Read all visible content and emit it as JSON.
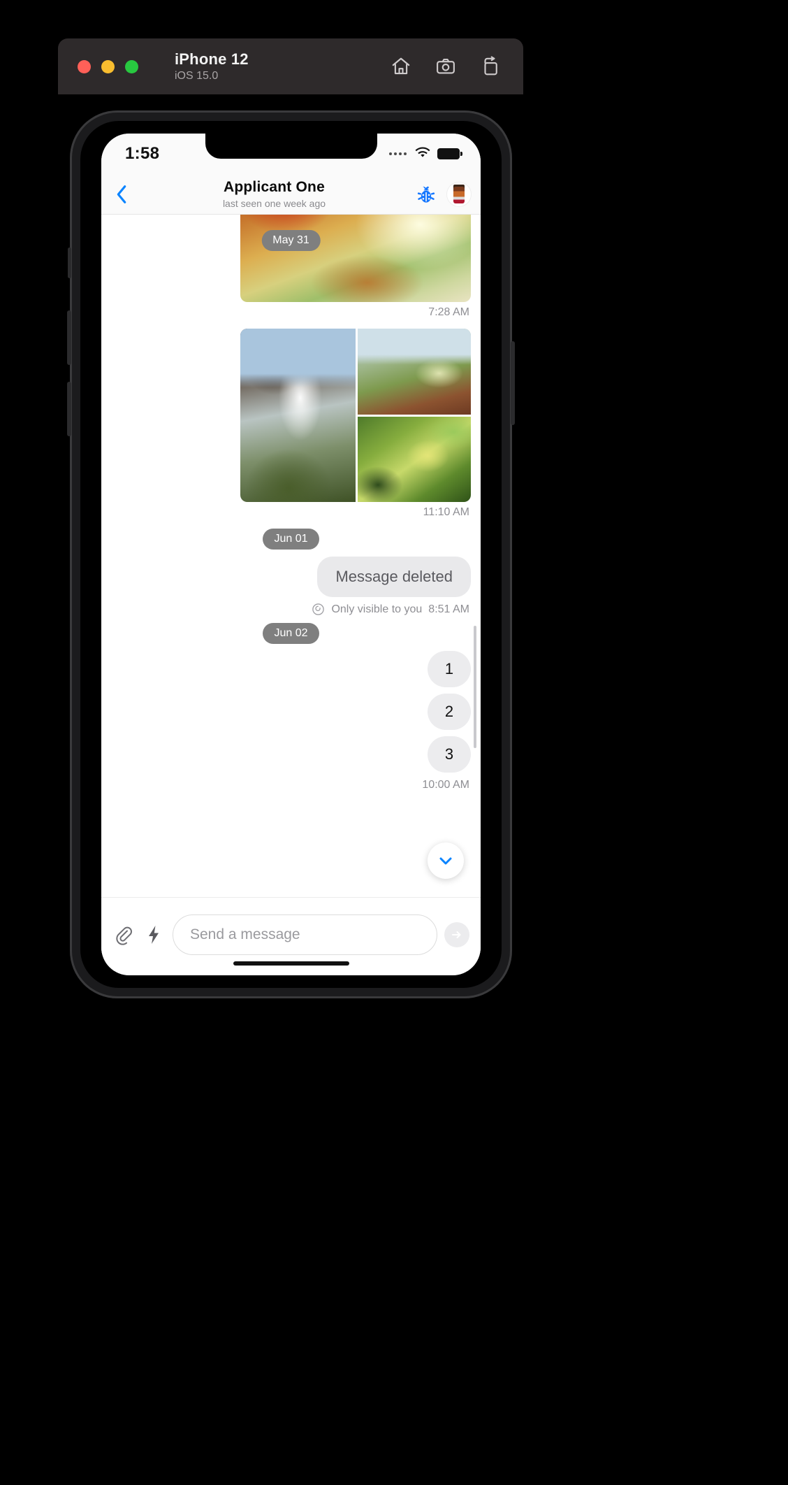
{
  "simulator": {
    "device_title": "iPhone 12",
    "os_version": "iOS 15.0",
    "traffic_lights": [
      {
        "name": "close",
        "color": "#ff6058"
      },
      {
        "name": "minimize",
        "color": "#f9bd2f"
      },
      {
        "name": "maximize",
        "color": "#28c840"
      }
    ],
    "actions": [
      {
        "name": "home-icon",
        "label": "Home"
      },
      {
        "name": "screenshot-icon",
        "label": "Screenshot"
      },
      {
        "name": "rotate-icon",
        "label": "Rotate"
      }
    ]
  },
  "status_bar": {
    "time": "1:58",
    "wifi": "wifi-icon",
    "battery": "battery-icon"
  },
  "chat_header": {
    "back": "‹",
    "name": "Applicant  One",
    "subtitle": "last seen one week ago",
    "bug_icon": "bug-icon",
    "avatar": "avatar"
  },
  "messages": {
    "date_chip_1": "May 31",
    "photo_1_time": "7:28 AM",
    "photo_grid_time": "11:10 AM",
    "date_chip_2": "Jun 01",
    "deleted_text": "Message deleted",
    "deleted_note": "Only visible to you",
    "deleted_time": "8:51 AM",
    "date_chip_3": "Jun 02",
    "numbered": [
      "1",
      "2",
      "3"
    ],
    "last_time": "10:00 AM"
  },
  "composer": {
    "attach_icon": "paperclip-icon",
    "quick_icon": "lightning-icon",
    "placeholder": "Send a message",
    "value": "",
    "send_icon": "send-arrow-icon"
  },
  "colors": {
    "accent_blue": "#0b84ff",
    "chip_grey": "#7f7f7f",
    "bubble_grey": "#e9e9eb",
    "toolbar_bg": "#2e2a2b"
  }
}
